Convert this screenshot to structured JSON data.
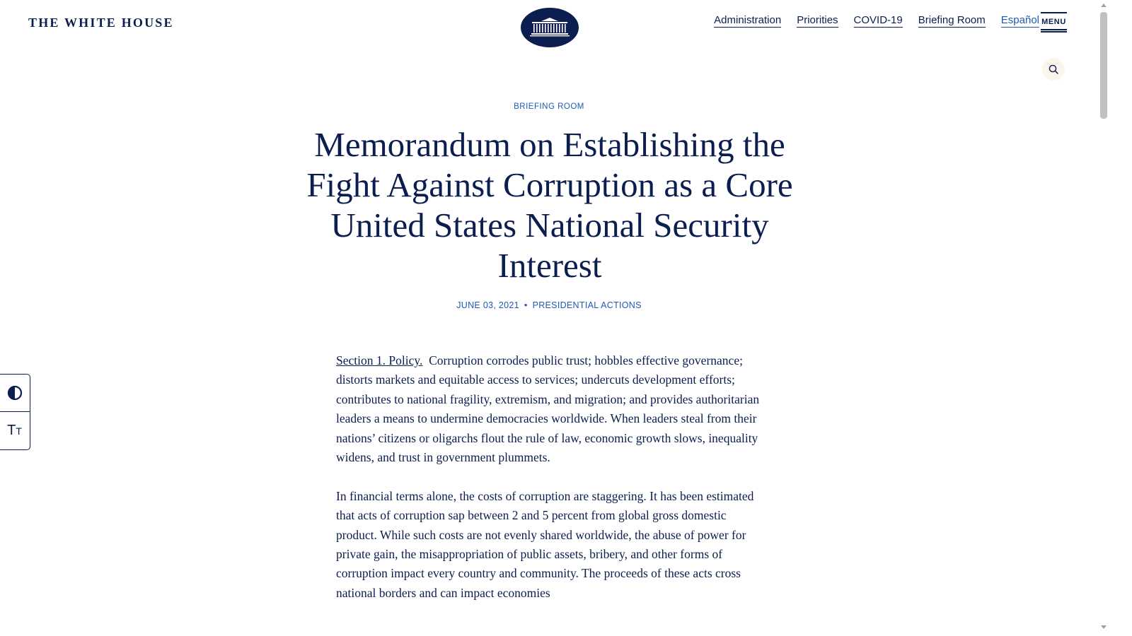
{
  "header": {
    "site_title": "THE WHITE HOUSE",
    "nav": {
      "administration": "Administration",
      "priorities": "Priorities",
      "covid": "COVID-19",
      "briefing_room": "Briefing Room",
      "espanol": "Español"
    },
    "menu_label": "MENU"
  },
  "article": {
    "category": "BRIEFING ROOM",
    "title": "Memorandum on Establishing the Fight Against Corruption as a Core United States National Security Interest",
    "date": "JUNE 03, 2021",
    "type": "PRESIDENTIAL ACTIONS",
    "section_heading": "Section 1.  Policy.",
    "paragraph_1": "Corruption corrodes public trust; hobbles effective governance; distorts markets and equitable access to services; undercuts development efforts; contributes to national fragility, extremism, and migration; and provides authoritarian leaders a means to undermine democracies worldwide.  When leaders steal from their nations’ citizens or oligarchs flout the rule of law, economic growth slows, inequality widens, and trust in government plummets.",
    "paragraph_2": "In financial terms alone, the costs of corruption are staggering.  It has been estimated that acts of corruption sap between 2 and 5 percent from global gross domestic product.  While such costs are not evenly shared worldwide, the abuse of power for private gain, the misappropriation of public assets, bribery, and other forms of corruption impact every country and community.  The proceeds of these acts cross national borders and can impact economies"
  },
  "colors": {
    "navy": "#0c1e4f",
    "link_blue": "#1e5ab5",
    "search_bg": "#fbf6ec"
  },
  "icons": {
    "seal": "white-house-seal-icon",
    "search": "search-icon",
    "contrast": "contrast-icon",
    "text_size": "text-size-icon"
  }
}
